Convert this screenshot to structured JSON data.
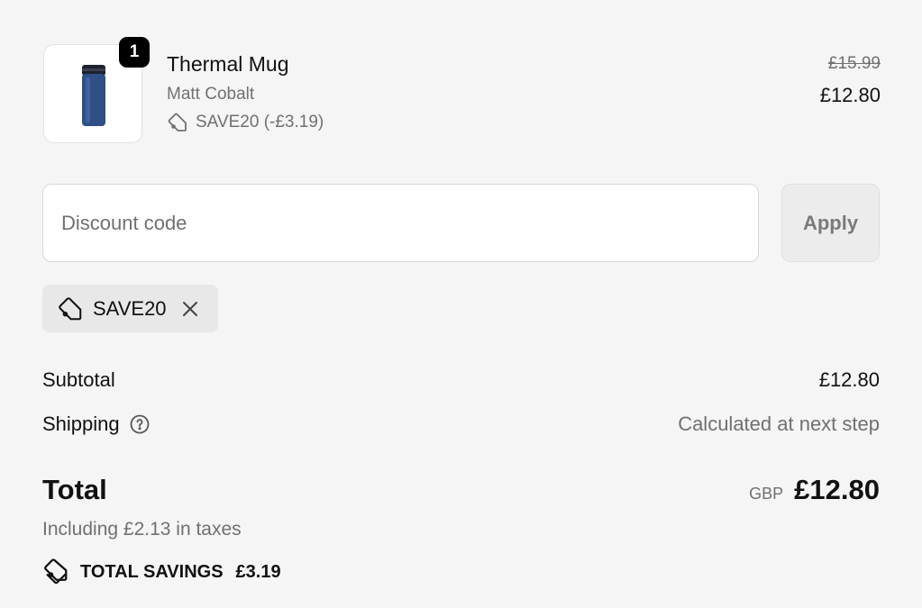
{
  "line_item": {
    "quantity": "1",
    "title": "Thermal Mug",
    "variant": "Matt Cobalt",
    "discount": "SAVE20 (-£3.19)",
    "compare_price": "£15.99",
    "price": "£12.80",
    "image_icon": "thermal-mug-image"
  },
  "discount_form": {
    "placeholder": "Discount code",
    "value": "",
    "apply_label": "Apply"
  },
  "applied_code": {
    "label": "SAVE20",
    "icon": "tag-icon",
    "remove_icon": "close-icon"
  },
  "summary": {
    "subtotal_label": "Subtotal",
    "subtotal_value": "£12.80",
    "shipping_label": "Shipping",
    "shipping_value": "Calculated at next step",
    "shipping_help_icon": "question-circle-icon",
    "total_label": "Total",
    "currency": "GBP",
    "total_value": "£12.80",
    "tax_note": "Including £2.13 in taxes",
    "savings_label": "TOTAL SAVINGS",
    "savings_value": "£3.19"
  },
  "colors": {
    "background": "#f5f5f5",
    "text": "#111111",
    "muted": "#707070",
    "badge": "#000000",
    "mug_body": "#2f4f86"
  }
}
